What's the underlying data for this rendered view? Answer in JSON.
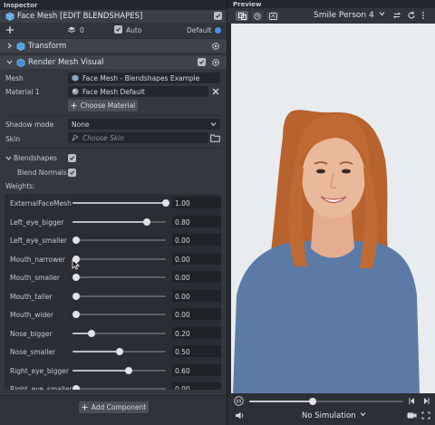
{
  "inspector": {
    "title": "Inspector",
    "object_name": "Face Mesh [EDIT BLENDSHAPES]",
    "layer_count": "0",
    "auto_label": "Auto",
    "default_label": "Default",
    "icons": [
      "plus-icon",
      "layers-icon",
      "gear-icon",
      "chevron-right-icon",
      "chevron-down-icon",
      "checkbox-icon",
      "folder-icon",
      "close-icon"
    ]
  },
  "transform": {
    "label": "Transform"
  },
  "render_mesh": {
    "label": "Render Mesh Visual",
    "mesh_label": "Mesh",
    "mesh_value": "Face Mesh - Blendshapes Example",
    "material_label": "Material 1",
    "material_value": "Face Mesh Default",
    "choose_material": "Choose Material",
    "shadow_label": "Shadow mode",
    "shadow_value": "None",
    "skin_label": "Skin",
    "skin_placeholder": "Choose Skin",
    "blendshapes_label": "Blendshapes",
    "blend_normals_label": "Blend Normals",
    "weights_label": "Weights:"
  },
  "weights": [
    {
      "name": "ExternalFaceMesh",
      "value": 1.0,
      "display": "1.00"
    },
    {
      "name": "Left_eye_bigger",
      "value": 0.8,
      "display": "0.80"
    },
    {
      "name": "Left_eye_smaller",
      "value": 0.0,
      "display": "0.00"
    },
    {
      "name": "Mouth_narrower",
      "value": 0.0,
      "display": "0.00"
    },
    {
      "name": "Mouth_smaller",
      "value": 0.0,
      "display": "0.00"
    },
    {
      "name": "Mouth_taller",
      "value": 0.0,
      "display": "0.00"
    },
    {
      "name": "Mouth_wider",
      "value": 0.0,
      "display": "0.00"
    },
    {
      "name": "Nose_bigger",
      "value": 0.2,
      "display": "0.20"
    },
    {
      "name": "Nose_smaller",
      "value": 0.5,
      "display": "0.50"
    },
    {
      "name": "Right_eye_bigger",
      "value": 0.6,
      "display": "0.60"
    },
    {
      "name": "Right_eye_smaller",
      "value": 0.0,
      "display": "0.00"
    }
  ],
  "footer": {
    "add_component": "Add Component"
  },
  "preview": {
    "title": "Preview",
    "person": "Smile Person 4",
    "playback_progress": 0.41,
    "simulation": "No Simulation",
    "colors": {
      "background": "#e9ecee",
      "shirt": "#5b7ba6",
      "hair": "#b8622d",
      "skin": "#eab89b"
    }
  },
  "colors": {
    "panel": "#33373f",
    "field": "#23262c",
    "accent": "#4a90e2"
  }
}
